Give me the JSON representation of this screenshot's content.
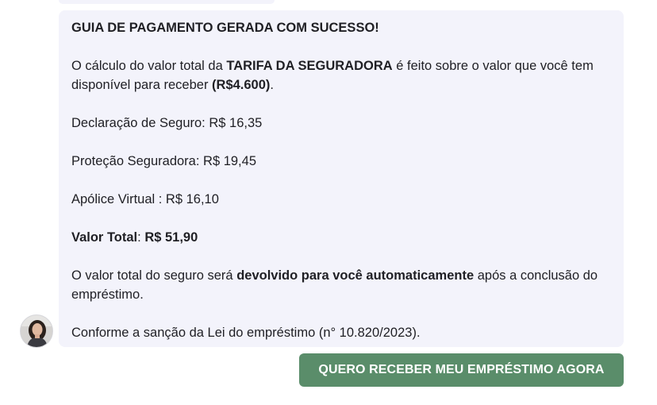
{
  "message": {
    "heading": "GUIA DE PAGAMENTO GERADA COM SUCESSO!",
    "calc_pre": "O cálculo do valor total da ",
    "calc_bold1": "TARIFA DA SEGURADORA",
    "calc_mid": " é feito sobre o valor que você tem disponível para receber ",
    "calc_bold2": "(R$4.600)",
    "calc_end": ".",
    "declaracao": "Declaração de Seguro: R$ 16,35",
    "protecao": "Proteção Seguradora: R$ 19,45",
    "apolice": "Apólice Virtual : R$ 16,10",
    "total_label": "Valor Total",
    "total_sep": ": ",
    "total_value": "R$ 51,90",
    "refund_pre": "O valor total do seguro será ",
    "refund_bold": "devolvido para você automaticamente",
    "refund_post": " após a conclusão do empréstimo.",
    "law": "Conforme a sanção da Lei do empréstimo (n° 10.820/2023)."
  },
  "cta": {
    "label": "QUERO RECEBER MEU EMPRÉSTIMO AGORA",
    "color": "#5a8d6a"
  },
  "colors": {
    "bubble_bg": "#f3f3fb",
    "text": "#1f1f24"
  },
  "avatar": {
    "icon": "agent-avatar-photo"
  }
}
